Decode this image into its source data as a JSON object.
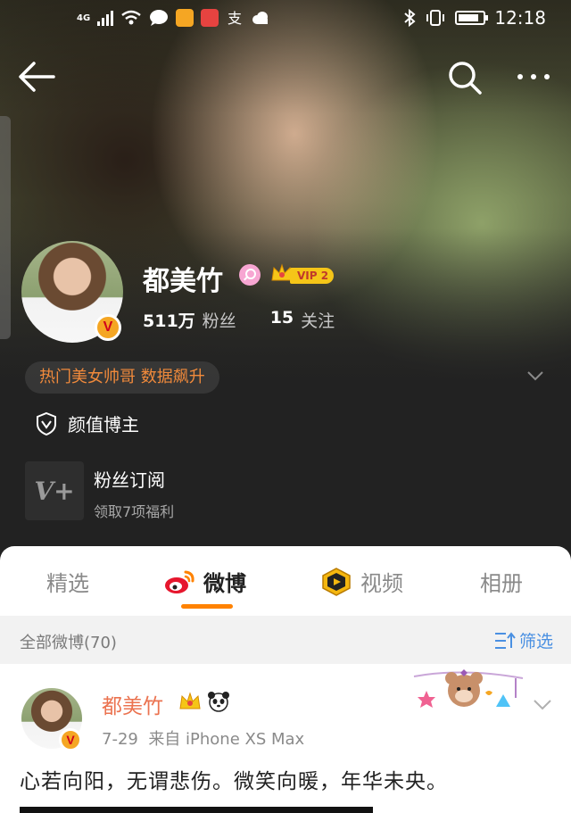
{
  "status_bar": {
    "network": "4G",
    "time": "12:18",
    "battery_level": 0.85
  },
  "nav": {
    "back_icon": "arrow-left-icon",
    "search_icon": "search-icon",
    "more_icon": "more-dots-icon"
  },
  "profile": {
    "name": "都美竹",
    "vip_label": "VIP 2",
    "followers_count": "511万",
    "followers_label": "粉丝",
    "following_count": "15",
    "following_label": "关注",
    "hot_tag": "热门美女帅哥 数据飙升",
    "certification": "颜值博主",
    "subscription_title": "粉丝订阅",
    "subscription_desc": "领取7项福利",
    "subscription_logo": "V+"
  },
  "tabs": [
    {
      "label": "精选",
      "active": false
    },
    {
      "label": "微博",
      "active": true
    },
    {
      "label": "视频",
      "active": false
    },
    {
      "label": "相册",
      "active": false
    }
  ],
  "filter": {
    "count_label": "全部微博(70)",
    "filter_label": "筛选"
  },
  "post": {
    "author": "都美竹",
    "date": "7-29",
    "source": "来自 iPhone XS Max",
    "text": "心若向阳，无谓悲伤。微笑向暖，年华未央。"
  },
  "colors": {
    "accent_orange": "#ff8200",
    "author_orange": "#eb7350",
    "hot_tag": "#f18a3b",
    "link_blue": "#4a90e2"
  }
}
